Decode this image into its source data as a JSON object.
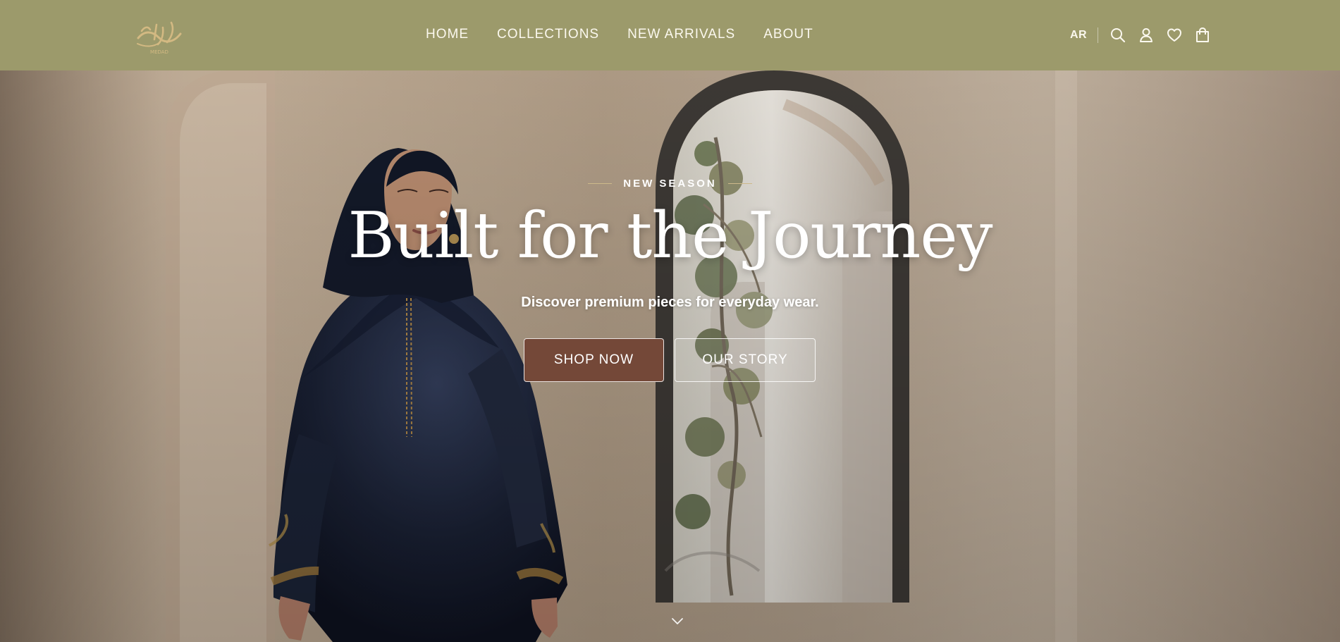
{
  "brand": {
    "logo_text": "مداد",
    "logo_caption": "MEDAD"
  },
  "nav": {
    "items": [
      {
        "label": "HOME"
      },
      {
        "label": "COLLECTIONS"
      },
      {
        "label": "NEW ARRIVALS"
      },
      {
        "label": "ABOUT"
      }
    ]
  },
  "header_tools": {
    "language": "AR",
    "icons": [
      "search-icon",
      "account-icon",
      "wishlist-icon",
      "bag-icon"
    ]
  },
  "hero": {
    "eyebrow": "NEW SEASON",
    "title": "Built for the Journey",
    "subtitle": "Discover premium pieces for everyday wear.",
    "primary_cta": "SHOP NOW",
    "secondary_cta": "OUR STORY",
    "scroll_icon": "chevron-down-icon"
  },
  "colors": {
    "header_bg": "#9c9a6b",
    "primary_button": "#744838",
    "gold_accent": "#cdb98a",
    "text_light": "#ffffff"
  }
}
